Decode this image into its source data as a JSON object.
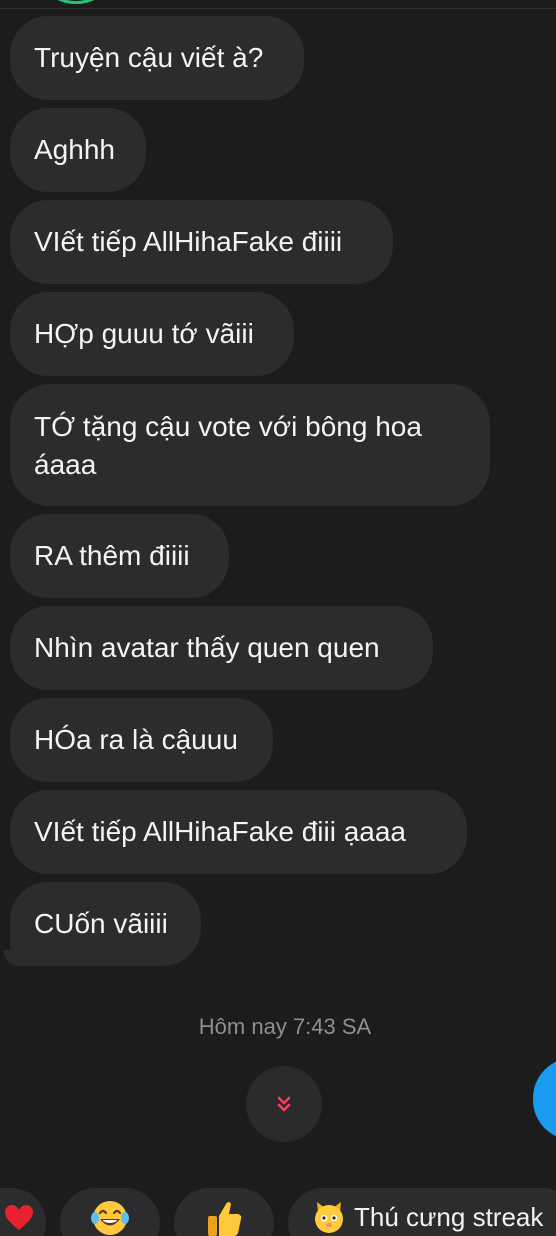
{
  "messages": [
    "Truyện cậu viết à?",
    "Aghhh",
    "VIết tiếp AllHihaFake điiii",
    "HỢp guuu tớ vãiii",
    "TỚ tặng cậu vote với bông hoa áaaa",
    "RA thêm điiii",
    "Nhìn avatar thấy quen quen",
    "HÓa ra là cậuuu",
    "VIết tiếp  AllHihaFake điii ạaaa",
    "CUốn vãiiii"
  ],
  "timestamp": "Hôm nay 7:43 SA",
  "quick_actions": {
    "streak_label": "Thú cưng streak"
  },
  "icons": {
    "scroll_down": "double-chevron-down-icon",
    "heart": "heart-icon",
    "laugh": "laughing-tears-emoji-icon",
    "thumbs_up": "thumbs-up-icon",
    "pet": "pet-face-icon"
  },
  "colors": {
    "background": "#1c1c1d",
    "bubble": "#2c2c2e",
    "accent_blue": "#1a9bf0",
    "avatar_ring": "#25c27a",
    "scroll_chevron": "#ff3b5c",
    "heart": "#e8222e"
  }
}
